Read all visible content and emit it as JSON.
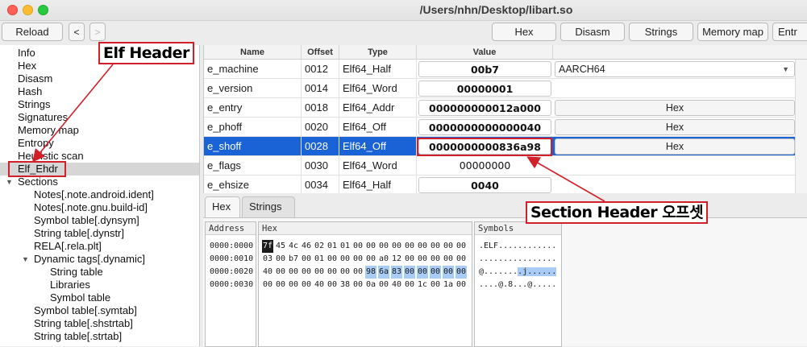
{
  "window": {
    "title": "/Users/nhn/Desktop/libart.so"
  },
  "toolbar": {
    "reload": "Reload",
    "back": "<",
    "forward": ">",
    "buttons": [
      "Hex",
      "Disasm",
      "Strings",
      "Memory map",
      "Entr"
    ]
  },
  "tree": [
    {
      "label": "Info",
      "level": 0
    },
    {
      "label": "Hex",
      "level": 0
    },
    {
      "label": "Disasm",
      "level": 0
    },
    {
      "label": "Hash",
      "level": 0
    },
    {
      "label": "Strings",
      "level": 0
    },
    {
      "label": "Signatures",
      "level": 0
    },
    {
      "label": "Memory map",
      "level": 0
    },
    {
      "label": "Entropy",
      "level": 0
    },
    {
      "label": "Heuristic scan",
      "level": 0
    },
    {
      "label": "Elf_Ehdr",
      "level": 0,
      "selected": true
    },
    {
      "label": "Sections",
      "level": 0,
      "expanded": true
    },
    {
      "label": "Notes[.note.android.ident]",
      "level": 1
    },
    {
      "label": "Notes[.note.gnu.build-id]",
      "level": 1
    },
    {
      "label": "Symbol table[.dynsym]",
      "level": 1
    },
    {
      "label": "String table[.dynstr]",
      "level": 1
    },
    {
      "label": "RELA[.rela.plt]",
      "level": 1
    },
    {
      "label": "Dynamic tags[.dynamic]",
      "level": 1,
      "expanded": true
    },
    {
      "label": "String table",
      "level": 2
    },
    {
      "label": "Libraries",
      "level": 2
    },
    {
      "label": "Symbol table",
      "level": 2
    },
    {
      "label": "Symbol table[.symtab]",
      "level": 1
    },
    {
      "label": "String table[.shstrtab]",
      "level": 1
    },
    {
      "label": "String table[.strtab]",
      "level": 1
    }
  ],
  "table": {
    "headers": [
      "Name",
      "Offset",
      "Type",
      "Value"
    ],
    "rows": [
      {
        "name": "e_machine",
        "offset": "0012",
        "type": "Elf64_Half",
        "value": "00b7",
        "boxed": true,
        "extra": "AARCH64",
        "extra_kind": "combo"
      },
      {
        "name": "e_version",
        "offset": "0014",
        "type": "Elf64_Word",
        "value": "00000001",
        "boxed": true,
        "extra": "",
        "extra_kind": "none"
      },
      {
        "name": "e_entry",
        "offset": "0018",
        "type": "Elf64_Addr",
        "value": "000000000012a000",
        "boxed": true,
        "extra": "Hex",
        "extra_kind": "button"
      },
      {
        "name": "e_phoff",
        "offset": "0020",
        "type": "Elf64_Off",
        "value": "0000000000000040",
        "boxed": true,
        "extra": "Hex",
        "extra_kind": "button"
      },
      {
        "name": "e_shoff",
        "offset": "0028",
        "type": "Elf64_Off",
        "value": "0000000000836a98",
        "boxed": true,
        "extra": "Hex",
        "extra_kind": "button",
        "selected": true
      },
      {
        "name": "e_flags",
        "offset": "0030",
        "type": "Elf64_Word",
        "value": "00000000",
        "boxed": false,
        "extra": "",
        "extra_kind": "none"
      },
      {
        "name": "e_ehsize",
        "offset": "0034",
        "type": "Elf64_Half",
        "value": "0040",
        "boxed": true,
        "extra": "",
        "extra_kind": "none"
      }
    ]
  },
  "lower_tabs": [
    "Hex",
    "Strings"
  ],
  "hexview": {
    "address_header": "Address",
    "hex_header": "Hex",
    "symbols_header": "Symbols",
    "lines": [
      {
        "address": "0000:0000",
        "bytes": [
          "7f",
          "45",
          "4c",
          "46",
          "02",
          "01",
          "01",
          "00",
          "00",
          "00",
          "00",
          "00",
          "00",
          "00",
          "00",
          "00"
        ],
        "symbols": ".ELF............"
      },
      {
        "address": "0000:0010",
        "bytes": [
          "03",
          "00",
          "b7",
          "00",
          "01",
          "00",
          "00",
          "00",
          "00",
          "a0",
          "12",
          "00",
          "00",
          "00",
          "00",
          "00"
        ],
        "symbols": "................"
      },
      {
        "address": "0000:0020",
        "bytes": [
          "40",
          "00",
          "00",
          "00",
          "00",
          "00",
          "00",
          "00",
          "98",
          "6a",
          "83",
          "00",
          "00",
          "00",
          "00",
          "00"
        ],
        "symbols": "@........j......"
      },
      {
        "address": "0000:0030",
        "bytes": [
          "00",
          "00",
          "00",
          "00",
          "40",
          "00",
          "38",
          "00",
          "0a",
          "00",
          "40",
          "00",
          "1c",
          "00",
          "1a",
          "00"
        ],
        "symbols": "....@.8...@....."
      }
    ]
  },
  "annotations": {
    "elf_header": "Elf Header",
    "section_header": "Section Header 오프셋"
  },
  "colors": {
    "selection": "#1a63d6",
    "annotation": "#d2202a",
    "hex_highlight": "#a9ccf6"
  }
}
